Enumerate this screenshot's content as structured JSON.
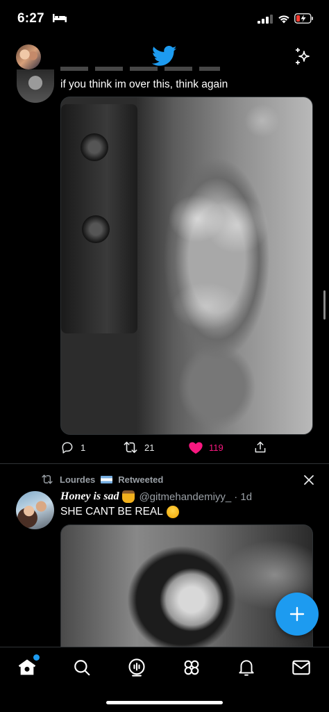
{
  "status_bar": {
    "time": "6:27",
    "battery_color": "#ff3b30"
  },
  "topnav": {
    "logo": "twitter-bird-icon",
    "accent": "#1d9bf0"
  },
  "tweet1": {
    "text": "if you think im over this, think again",
    "replies": "1",
    "retweets": "21",
    "likes": "119",
    "liked": true,
    "like_color": "#f91880"
  },
  "tweet2": {
    "retweeted_by": "Lourdes",
    "retweeted_label": "Retweeted",
    "author_name": "Honey is sad",
    "handle": "@gitmehandemiyy_",
    "time": "· 1d",
    "text": "SHE CANT BE REAL"
  },
  "bottomnav": {
    "tabs": [
      "home-icon",
      "search-icon",
      "spaces-icon",
      "communities-icon",
      "notifications-icon",
      "messages-icon"
    ],
    "active": "home-icon"
  }
}
